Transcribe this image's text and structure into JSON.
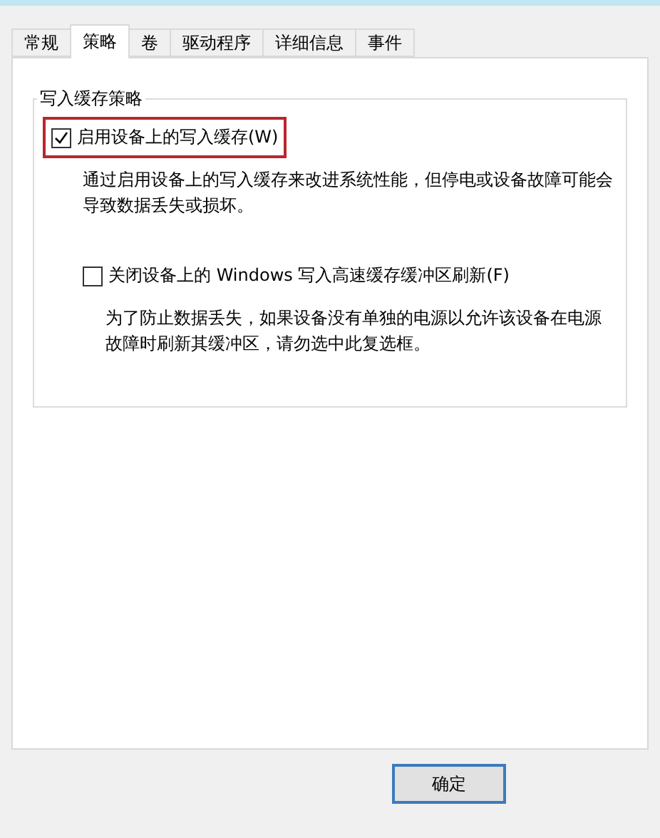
{
  "tabs": [
    {
      "label": "常规",
      "selected": false
    },
    {
      "label": "策略",
      "selected": true
    },
    {
      "label": "卷",
      "selected": false
    },
    {
      "label": "驱动程序",
      "selected": false
    },
    {
      "label": "详细信息",
      "selected": false
    },
    {
      "label": "事件",
      "selected": false
    }
  ],
  "group": {
    "title": "写入缓存策略",
    "options": [
      {
        "label": "启用设备上的写入缓存(W)",
        "checked": true,
        "highlighted": true,
        "description": "通过启用设备上的写入缓存来改进系统性能，但停电或设备故障可能会导致数据丢失或损坏。"
      },
      {
        "label": "关闭设备上的 Windows 写入高速缓存缓冲区刷新(F)",
        "checked": false,
        "highlighted": false,
        "description": "为了防止数据丢失，如果设备没有单独的电源以允许该设备在电源故障时刷新其缓冲区，请勿选中此复选框。"
      }
    ]
  },
  "buttons": [
    "确定"
  ]
}
